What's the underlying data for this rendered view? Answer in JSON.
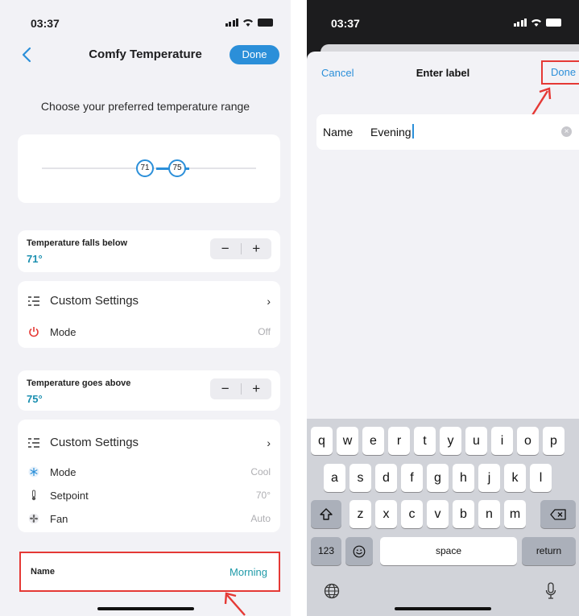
{
  "left_phone": {
    "status": {
      "time": "03:37"
    },
    "nav": {
      "title": "Comfy Temperature",
      "done": "Done"
    },
    "prompt": "Choose your preferred temperature range",
    "slider": {
      "low": "71",
      "high": "75"
    },
    "below": {
      "label": "Temperature falls below",
      "value": "71°",
      "minus": "−",
      "plus": "+",
      "custom_settings": "Custom Settings",
      "rows": [
        {
          "label": "Mode",
          "value": "Off",
          "icon": "power-icon"
        }
      ]
    },
    "above": {
      "label": "Temperature goes above",
      "value": "75°",
      "minus": "−",
      "plus": "+",
      "custom_settings": "Custom Settings",
      "rows": [
        {
          "label": "Mode",
          "value": "Cool",
          "icon": "snowflake-icon"
        },
        {
          "label": "Setpoint",
          "value": "70°",
          "icon": "thermometer-icon"
        },
        {
          "label": "Fan",
          "value": "Auto",
          "icon": "fan-icon"
        }
      ]
    },
    "name_row": {
      "label": "Name",
      "value": "Morning"
    }
  },
  "right_phone": {
    "status": {
      "time": "03:37"
    },
    "sheet": {
      "cancel": "Cancel",
      "title": "Enter label",
      "done": "Done"
    },
    "field": {
      "label": "Name",
      "value": "Evening"
    },
    "keyboard": {
      "row1": [
        "q",
        "w",
        "e",
        "r",
        "t",
        "y",
        "u",
        "i",
        "o",
        "p"
      ],
      "row2": [
        "a",
        "s",
        "d",
        "f",
        "g",
        "h",
        "j",
        "k",
        "l"
      ],
      "row3": [
        "z",
        "x",
        "c",
        "v",
        "b",
        "n",
        "m"
      ],
      "numbers": "123",
      "space": "space",
      "return": "return"
    }
  },
  "colors": {
    "accent": "#2b8fd9",
    "teal_value": "#1a8fb0",
    "highlight": "#e53935",
    "background": "#f2f2f6"
  }
}
